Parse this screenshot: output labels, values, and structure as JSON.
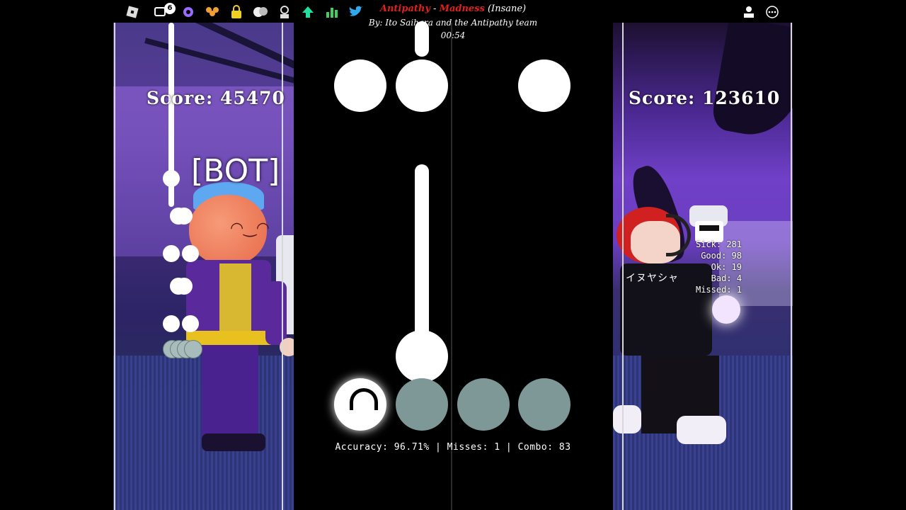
{
  "song": {
    "name": "Antipathy",
    "separator": "-",
    "chart": "Madness",
    "difficulty": "(Insane)",
    "author": "By: Ito Saihara and the Antipathy team",
    "time": "00:54"
  },
  "topbar": {
    "notification_count": "6"
  },
  "bot_side": {
    "score": "Score: 45470",
    "tag": "[BOT]"
  },
  "player_side": {
    "score": "Score: 123610",
    "judgements": [
      {
        "label": "Sick: 281"
      },
      {
        "label": "Good: 98"
      },
      {
        "label": "Ok: 19"
      },
      {
        "label": "Bad: 4"
      },
      {
        "label": "Missed: 1"
      }
    ],
    "shirt_text": "イヌヤシャ"
  },
  "stats": {
    "text": "Accuracy: 96.71% | Misses: 1 | Combo: 83"
  },
  "colors": {
    "accent_red": "#e02020",
    "receptor_idle": "#7e9898",
    "note": "#ffffff"
  }
}
